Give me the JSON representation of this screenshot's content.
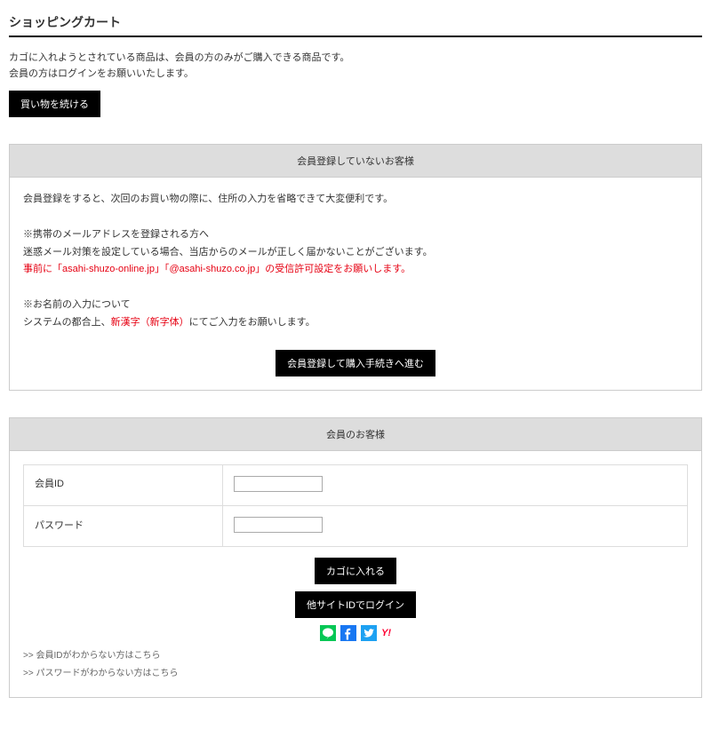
{
  "title": "ショッピングカート",
  "intro_line1": "カゴに入れようとされている商品は、会員の方のみがご購入できる商品です。",
  "intro_line2": "会員の方はログインをお願いいたします。",
  "continue_shopping": "買い物を続ける",
  "nonmember": {
    "header": "会員登録していないお客様",
    "benefit": "会員登録をすると、次回のお買い物の際に、住所の入力を省略できて大変便利です。",
    "mobile_title": "※携帯のメールアドレスを登録される方へ",
    "mobile_body": "迷惑メール対策を設定している場合、当店からのメールが正しく届かないことがございます。",
    "mobile_red": "事前に「asahi-shuzo-online.jp」「@asahi-shuzo.co.jp」の受信許可設定をお願いします。",
    "name_title": "※お名前の入力について",
    "name_before": "システムの都合上、",
    "name_red": "新漢字（新字体）",
    "name_after": "にてご入力をお願いします。",
    "register_button": "会員登録して購入手続きへ進む"
  },
  "member": {
    "header": "会員のお客様",
    "id_label": "会員ID",
    "password_label": "パスワード",
    "add_to_cart": "カゴに入れる",
    "social_login": "他サイトIDでログイン",
    "forgot_id": ">> 会員IDがわからない方はこちら",
    "forgot_pw": ">> パスワードがわからない方はこちら"
  },
  "social": {
    "line": "LINE",
    "facebook": "Facebook",
    "twitter": "Twitter",
    "yahoo": "Y!"
  }
}
